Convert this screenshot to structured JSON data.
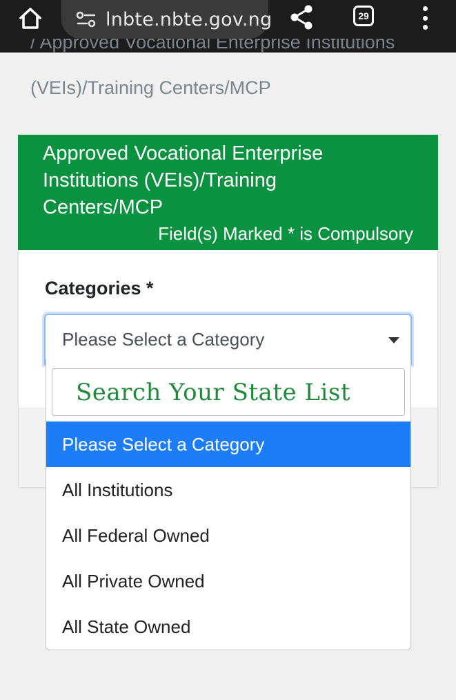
{
  "browser": {
    "url": "lnbte.nbte.gov.ng",
    "tab_count": "29",
    "icons": {
      "home": "home-icon",
      "site_info": "tune-icon",
      "share": "share-icon",
      "menu": "more-vert-icon"
    }
  },
  "breadcrumb": {
    "line1": "/ Approved Vocational Enterprise Institutions",
    "line2": "(VEIs)/Training Centers/MCP"
  },
  "card": {
    "header_color": "#0b9240",
    "title": "Approved Vocational Enterprise Institutions (VEIs)/Training Centers/MCP",
    "compulsory_note": "Field(s) Marked * is Compulsory"
  },
  "form": {
    "categories_label": "Categories *",
    "selected_value": "Please Select a Category"
  },
  "dropdown": {
    "search_placeholder": "Search Your State List",
    "highlight_color": "#1c7df7",
    "options": [
      {
        "label": "Please Select a Category",
        "selected": true
      },
      {
        "label": "All Institutions",
        "selected": false
      },
      {
        "label": "All Federal Owned",
        "selected": false
      },
      {
        "label": "All Private Owned",
        "selected": false
      },
      {
        "label": "All State Owned",
        "selected": false
      }
    ]
  }
}
